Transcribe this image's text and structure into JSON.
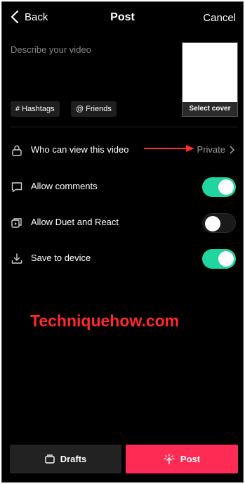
{
  "header": {
    "back_label": "Back",
    "title": "Post",
    "cancel_label": "Cancel"
  },
  "compose": {
    "description_placeholder": "Describe your video",
    "cover_label": "Select cover",
    "hashtags_symbol": "#",
    "hashtags_label": "Hashtags",
    "friends_symbol": "@",
    "friends_label": "Friends"
  },
  "settings": {
    "privacy": {
      "label": "Who can view this video",
      "value": "Private"
    },
    "comments": {
      "label": "Allow comments",
      "enabled": true
    },
    "duet": {
      "label": "Allow Duet and React",
      "enabled": false
    },
    "save": {
      "label": "Save to device",
      "enabled": true
    }
  },
  "watermark": "Techniquehow.com",
  "footer": {
    "drafts_label": "Drafts",
    "post_label": "Post"
  },
  "colors": {
    "accent_toggle": "#20d5a0",
    "post_button": "#fe2c55",
    "annotation": "#ff2a2a"
  }
}
